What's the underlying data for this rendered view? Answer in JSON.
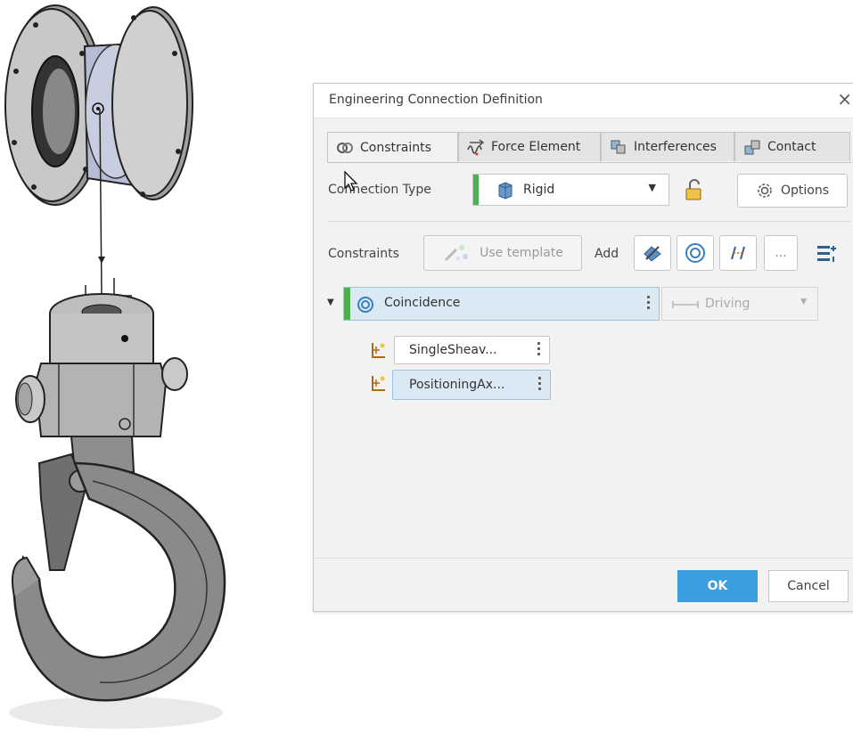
{
  "dialog": {
    "title": "Engineering Connection Definition",
    "close_glyph": "×",
    "tabs": [
      {
        "label": "Constraints",
        "icon": "constraints-icon",
        "active": true
      },
      {
        "label": "Force Element",
        "icon": "spring-icon",
        "active": false
      },
      {
        "label": "Interferences",
        "icon": "interferences-icon",
        "active": false
      },
      {
        "label": "Contact",
        "icon": "contact-icon",
        "active": false
      }
    ],
    "connection_type": {
      "label": "Connection Type",
      "value": "Rigid",
      "lock_icon": "lock-open-icon",
      "options_label": "Options"
    },
    "constraints_row": {
      "label": "Constraints",
      "use_template_label": "Use template",
      "add_label": "Add",
      "more_label": "..."
    },
    "coincidence": {
      "label": "Coincidence",
      "driving_label": "Driving",
      "items": [
        "SingleSheav...",
        "PositioningAx..."
      ]
    },
    "ok_label": "OK",
    "cancel_label": "Cancel"
  },
  "colors": {
    "accent_green": "#4caf50",
    "ok_blue": "#3b9ede",
    "selection_blue": "#dbe9f4"
  }
}
